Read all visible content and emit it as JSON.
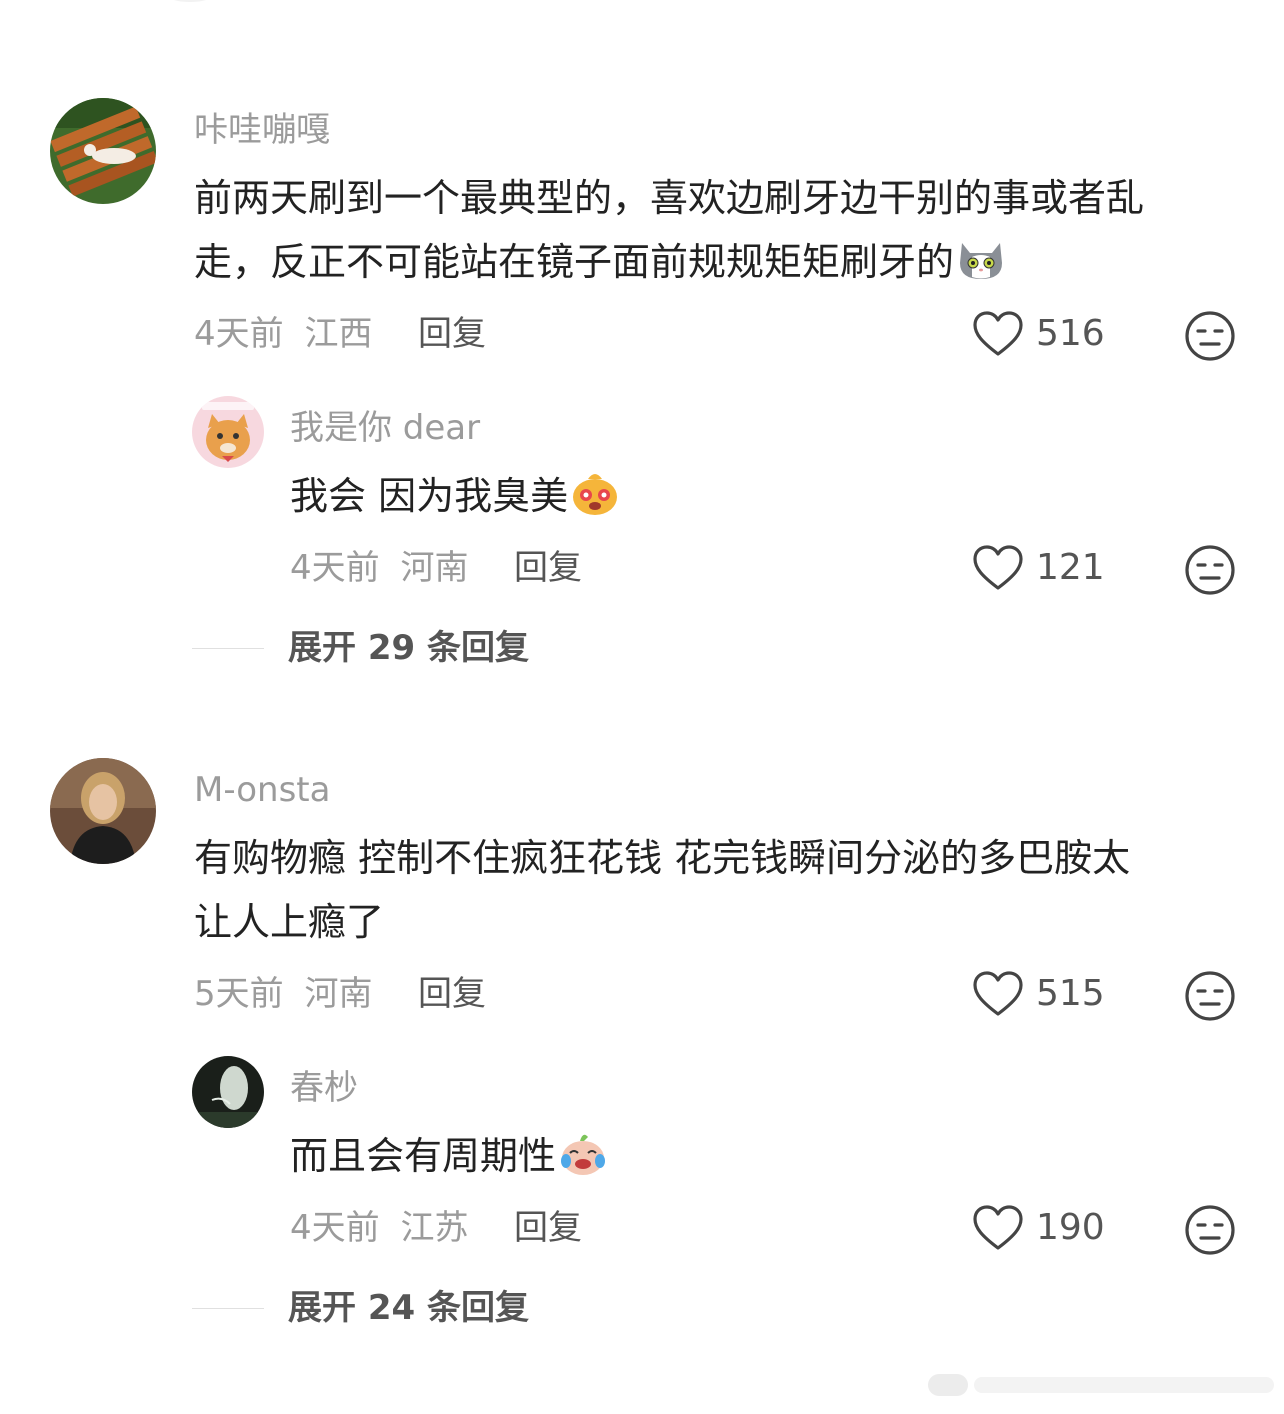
{
  "comments": [
    {
      "username": "咔哇嘣嘎",
      "text_line1": "前两天刷到一个最典型的，喜欢边刷牙边干别的事或者乱",
      "text_line2": "走，反正不可能站在镜子面前规规矩矩刷牙的",
      "text_emoji": "cat-face-emoji",
      "time": "4天前",
      "location": "江西",
      "reply_label": "回复",
      "likes": "516",
      "reply": {
        "username": "我是你 dear",
        "text": "我会 因为我臭美",
        "text_emoji": "star-eyes-emoji",
        "time": "4天前",
        "location": "河南",
        "reply_label": "回复",
        "likes": "121"
      },
      "expand_label": "展开 29 条回复"
    },
    {
      "username": "M-onsta",
      "text_line1": "有购物瘾 控制不住疯狂花钱 花完钱瞬间分泌的多巴胺太",
      "text_line2": "让人上瘾了",
      "time": "5天前",
      "location": "河南",
      "reply_label": "回复",
      "likes": "515",
      "reply": {
        "username": "春杪",
        "text": "而且会有周期性",
        "text_emoji": "laugh-cry-emoji",
        "time": "4天前",
        "location": "江苏",
        "reply_label": "回复",
        "likes": "190"
      },
      "expand_label": "展开 24 条回复"
    }
  ],
  "icons": {
    "like": "heart-outline-icon",
    "dislike": "neutral-face-icon"
  },
  "colors": {
    "username": "#9b9b9b",
    "body_text": "#222222",
    "action_text": "#555555"
  }
}
